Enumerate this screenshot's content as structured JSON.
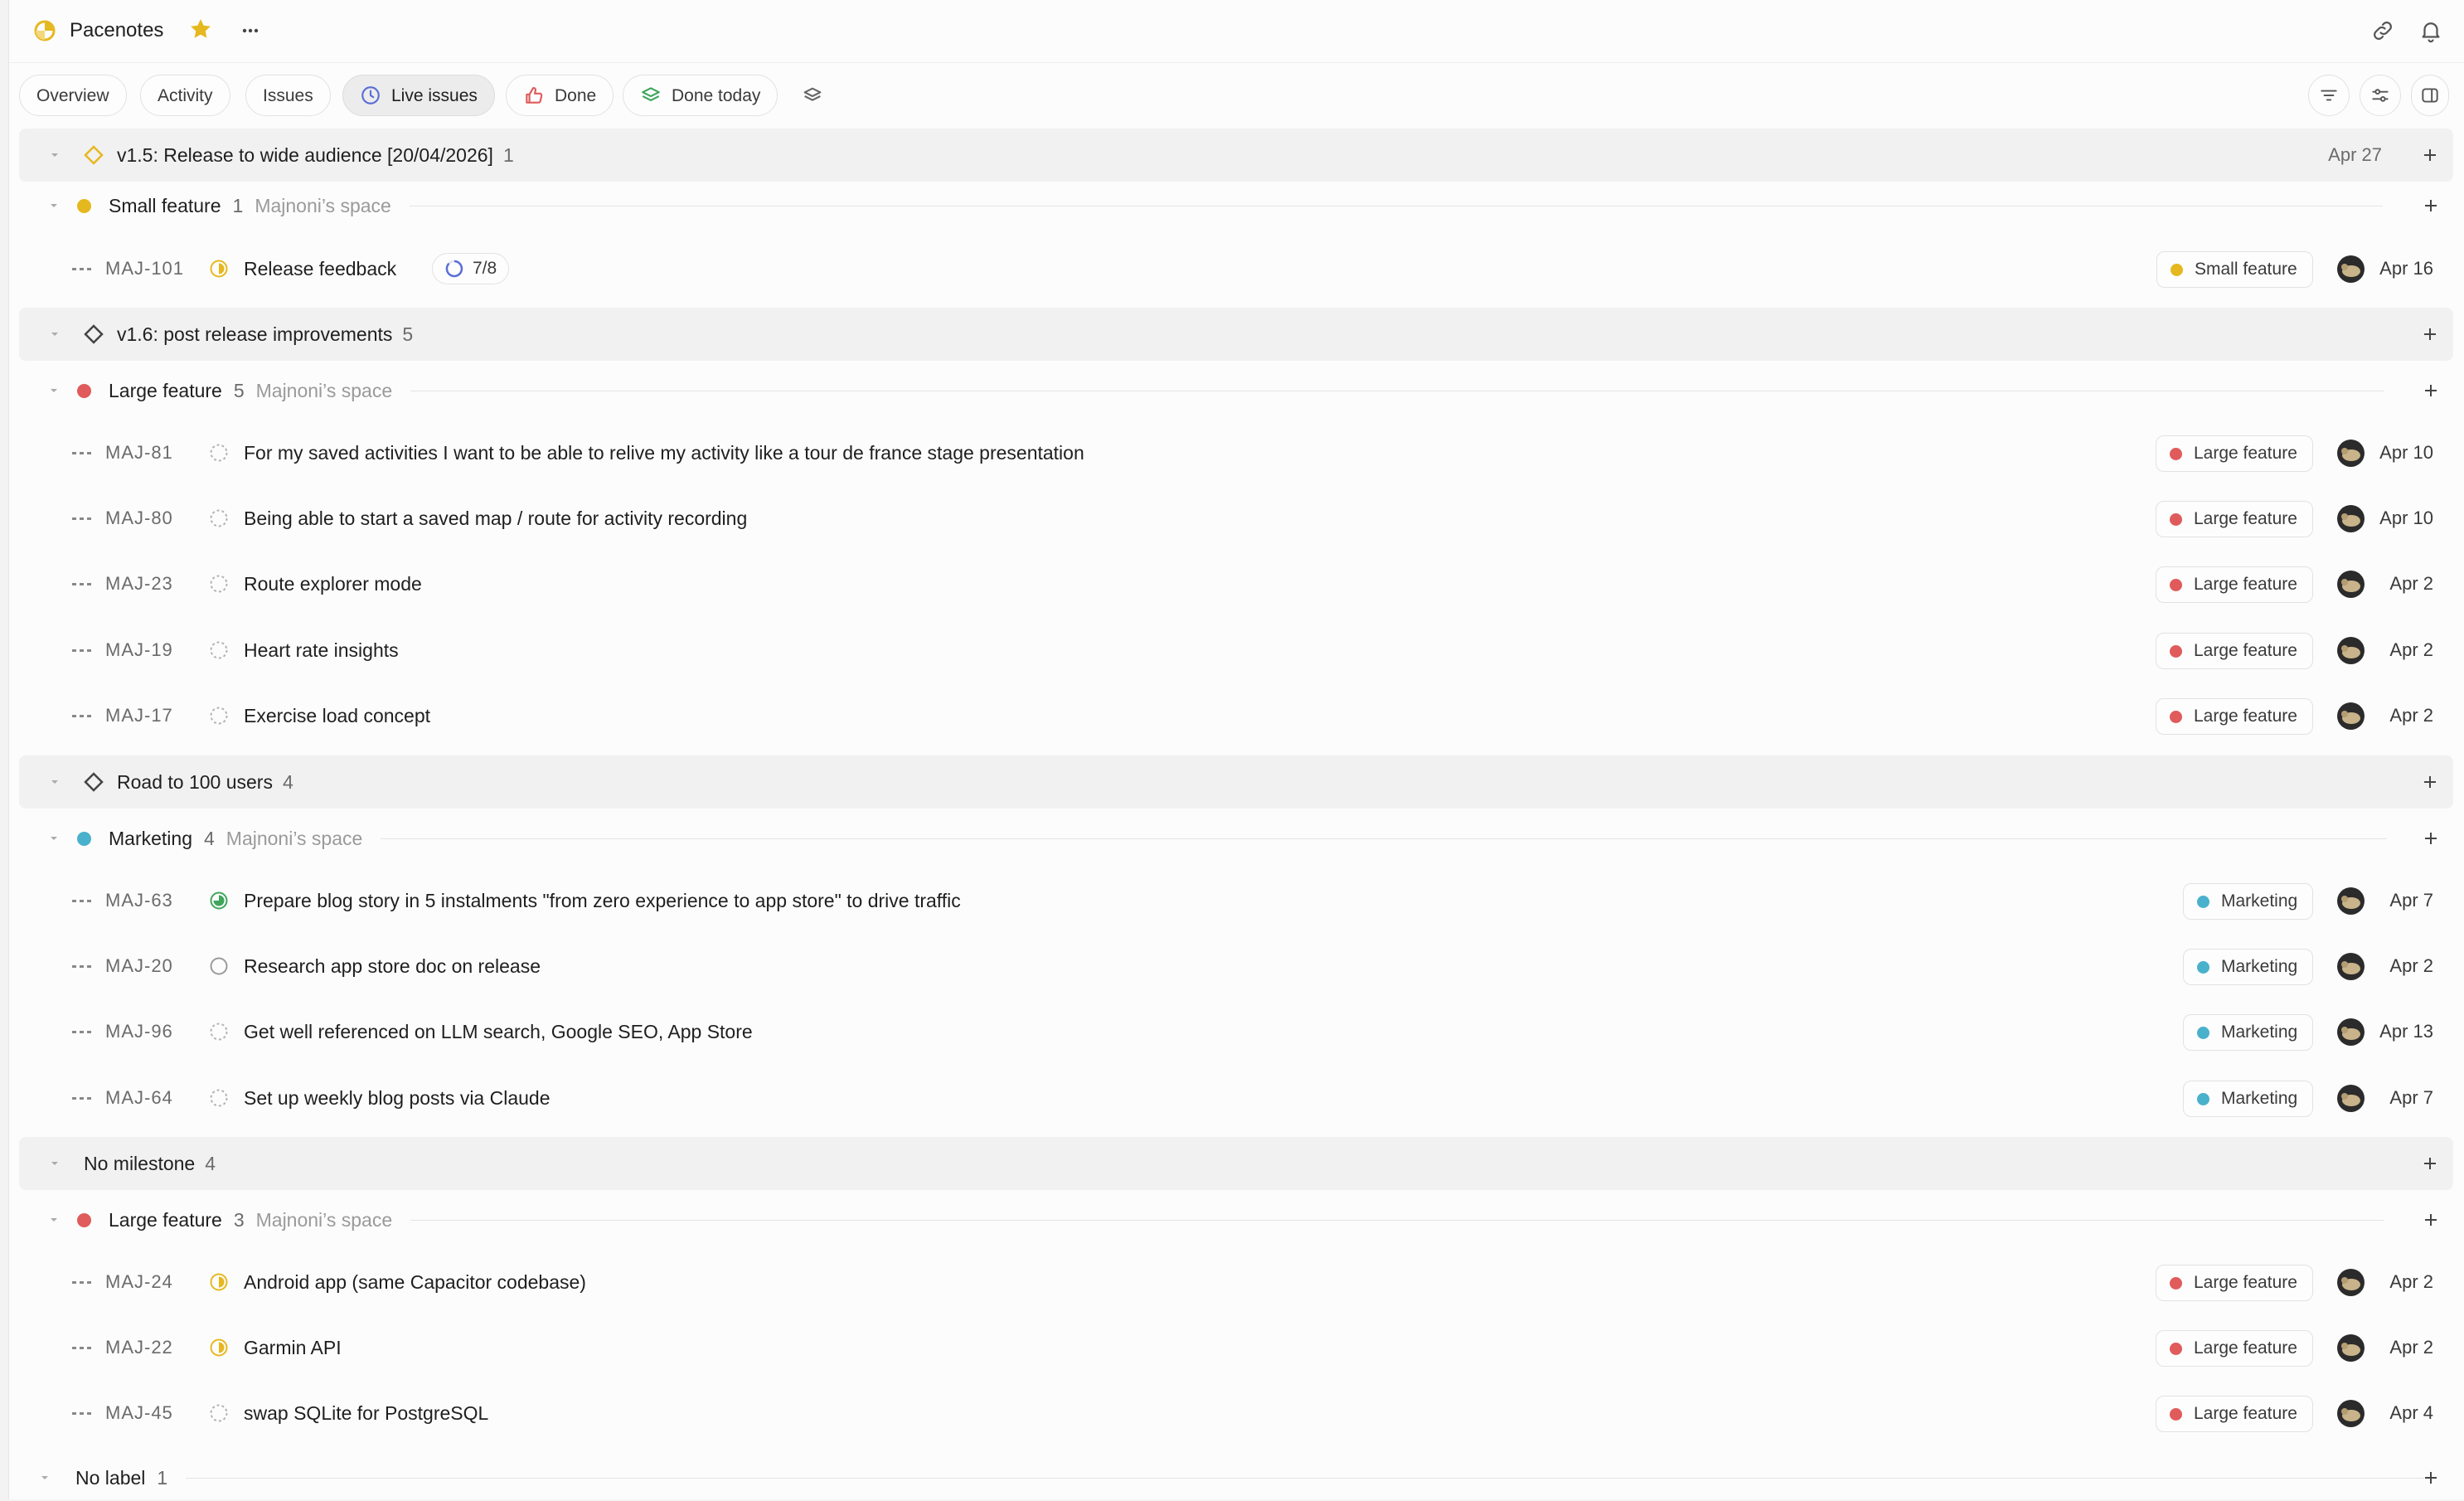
{
  "app": {
    "title": "Pacenotes"
  },
  "tabs": [
    {
      "label": "Overview",
      "active": false
    },
    {
      "label": "Activity",
      "active": false
    },
    {
      "label": "Issues",
      "active": false
    },
    {
      "label": "Live issues",
      "active": true
    },
    {
      "label": "Done",
      "active": false
    },
    {
      "label": "Done today",
      "active": false
    }
  ],
  "colors": {
    "yellow": "#e6b820",
    "red": "#e05b5b",
    "blue": "#4ab1cc",
    "green": "#3fa55c",
    "progress_blue": "#5a6fd6"
  },
  "sections": {
    "m1": {
      "title": "v1.5: Release to wide audience [20/04/2026]",
      "count": "1",
      "date": "Apr 27"
    },
    "g1": {
      "label": "Small feature",
      "count": "1",
      "space": "Majnoni’s space"
    },
    "r1": {
      "key": "MAJ-101",
      "title": "Release feedback",
      "progress": "7/8",
      "badge": "Small feature",
      "date": "Apr 16"
    },
    "m2": {
      "title": "v1.6: post release improvements",
      "count": "5"
    },
    "g2": {
      "label": "Large feature",
      "count": "5",
      "space": "Majnoni’s space"
    },
    "r2": {
      "key": "MAJ-81",
      "title": "For my saved activities I want to be able to relive my activity like a tour de france stage presentation",
      "badge": "Large feature",
      "date": "Apr 10"
    },
    "r3": {
      "key": "MAJ-80",
      "title": "Being able to start a saved map / route for activity recording",
      "badge": "Large feature",
      "date": "Apr 10"
    },
    "r4": {
      "key": "MAJ-23",
      "title": "Route explorer mode",
      "badge": "Large feature",
      "date": "Apr 2"
    },
    "r5": {
      "key": "MAJ-19",
      "title": "Heart rate insights",
      "badge": "Large feature",
      "date": "Apr 2"
    },
    "r6": {
      "key": "MAJ-17",
      "title": "Exercise load concept",
      "badge": "Large feature",
      "date": "Apr 2"
    },
    "m3": {
      "title": "Road to 100 users",
      "count": "4"
    },
    "g3": {
      "label": "Marketing",
      "count": "4",
      "space": "Majnoni’s space"
    },
    "r7": {
      "key": "MAJ-63",
      "title": "Prepare blog story in 5 instalments \"from zero experience to app store\" to drive traffic",
      "badge": "Marketing",
      "date": "Apr 7"
    },
    "r8": {
      "key": "MAJ-20",
      "title": "Research app store doc on release",
      "badge": "Marketing",
      "date": "Apr 2"
    },
    "r9": {
      "key": "MAJ-96",
      "title": "Get well referenced on LLM search, Google SEO, App Store",
      "badge": "Marketing",
      "date": "Apr 13"
    },
    "r10": {
      "key": "MAJ-64",
      "title": "Set up weekly blog posts via Claude",
      "badge": "Marketing",
      "date": "Apr 7"
    },
    "m4": {
      "title": "No milestone",
      "count": "4"
    },
    "g4": {
      "label": "Large feature",
      "count": "3",
      "space": "Majnoni’s space"
    },
    "r11": {
      "key": "MAJ-24",
      "title": "Android app (same Capacitor codebase)",
      "badge": "Large feature",
      "date": "Apr 2"
    },
    "r12": {
      "key": "MAJ-22",
      "title": "Garmin API",
      "badge": "Large feature",
      "date": "Apr 2"
    },
    "r13": {
      "key": "MAJ-45",
      "title": "swap SQLite for PostgreSQL",
      "badge": "Large feature",
      "date": "Apr 4"
    },
    "g5": {
      "label": "No label",
      "count": "1"
    }
  }
}
